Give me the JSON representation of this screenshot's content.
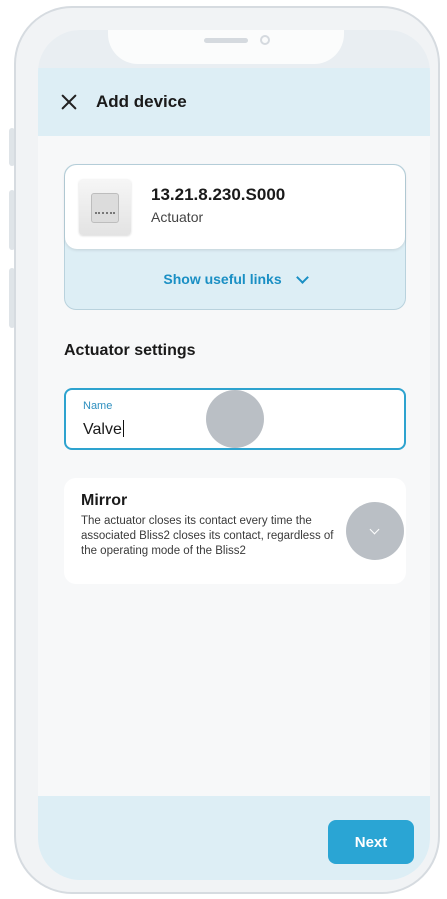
{
  "header": {
    "title": "Add device"
  },
  "device": {
    "code": "13.21.8.230.S000",
    "type": "Actuator",
    "links_label": "Show useful links"
  },
  "settings": {
    "title": "Actuator settings",
    "name_label": "Name",
    "name_value": "Valve"
  },
  "mirror": {
    "title": "Mirror",
    "description": "The actuator closes its contact every time the associated Bliss2 closes its contact, regardless of the operating mode of the Bliss2"
  },
  "footer": {
    "next_label": "Next"
  },
  "colors": {
    "accent": "#2aa5d4",
    "header_bg": "#ddeef5"
  }
}
